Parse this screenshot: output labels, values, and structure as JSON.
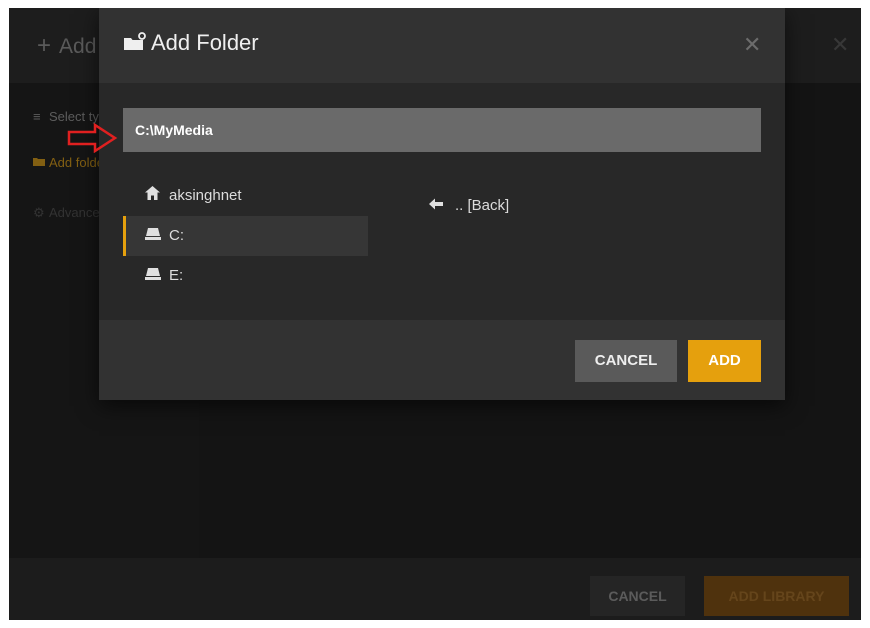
{
  "background": {
    "title": "Add Library",
    "sidebar": {
      "items": [
        {
          "label": "Select type",
          "icon": "list-icon"
        },
        {
          "label": "Add folders",
          "icon": "folder-icon"
        },
        {
          "label": "Advanced",
          "icon": "gear-icon"
        }
      ]
    },
    "footer": {
      "cancel_label": "CANCEL",
      "add_library_label": "ADD LIBRARY"
    }
  },
  "modal": {
    "title": "Add Folder",
    "close_symbol": "✕",
    "path_value": "C:\\MyMedia",
    "directories": [
      {
        "label": "aksinghnet",
        "icon": "home-icon"
      },
      {
        "label": "C:",
        "icon": "drive-icon",
        "selected": true
      },
      {
        "label": "E:",
        "icon": "drive-icon"
      }
    ],
    "back_label": ".. [Back]",
    "footer": {
      "cancel_label": "CANCEL",
      "add_label": "ADD"
    }
  },
  "colors": {
    "accent": "#e5a00d",
    "annotation": "#e02020"
  }
}
